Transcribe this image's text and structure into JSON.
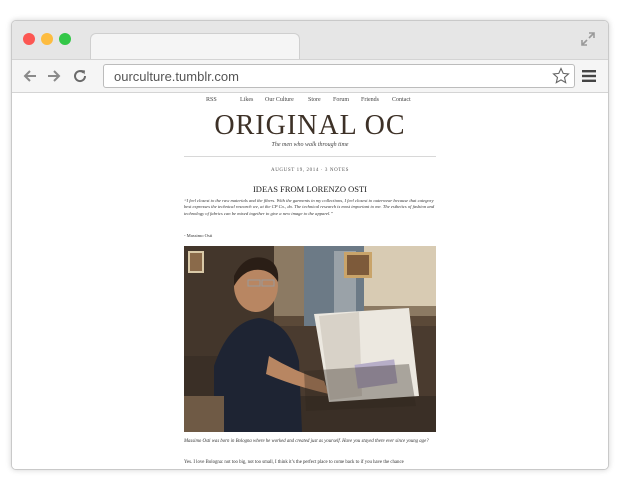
{
  "browser": {
    "url": "ourculture.tumblr.com",
    "icons": [
      "close-dot",
      "minimize-dot",
      "zoom-dot",
      "expand-icon",
      "back-arrow-icon",
      "forward-arrow-icon",
      "reload-icon",
      "star-icon",
      "menu-icon"
    ]
  },
  "site": {
    "nav": [
      "RSS",
      "Likes",
      "Our Culture",
      "Store",
      "Forum",
      "Friends",
      "Contact"
    ],
    "logo": "ORIGINAL OC",
    "tagline": "The men who walk through time",
    "post_meta": "AUGUST 19, 2014  ·  3 NOTES",
    "post_title": "IDEAS FROM LORENZO OSTI",
    "quote": "“I feel closest to the raw materials and the fibers. With the garments in my collections, I feel closest to outerwear because that category best expresses the technical research we, at the CP Co., do. The technical research is most important to me. The esthetics of fashion and technology of fabrics can be mixed together to give a new image to the apparel.”",
    "signature": "- Massimo Osti",
    "caption": "Massimo Osti was born in Bologna where he worked and created just as yourself. Have you stayed there ever since young age?",
    "body": "Yes. I love Bologna: not too big, not too small, I think it’s the perfect place to come back to if you have the chance"
  },
  "colors": {
    "titlebar": "#e6e6e6",
    "toolbar": "#f5f5f5",
    "close": "#fc5753",
    "minimize": "#fdbc40",
    "zoom": "#33c748",
    "logo": "#3d3127"
  }
}
